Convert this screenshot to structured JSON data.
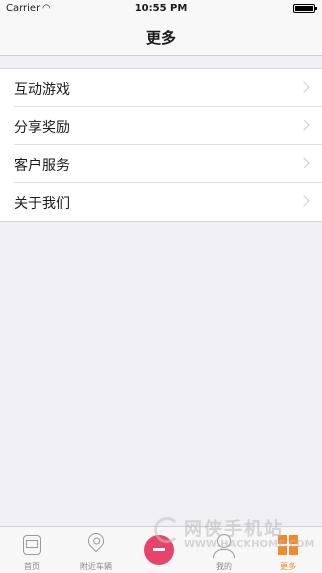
{
  "status_bar": {
    "carrier": "Carrier",
    "wifi_icon": "wifi-icon",
    "time": "10:55 PM",
    "battery_icon": "battery-icon"
  },
  "nav": {
    "title": "更多"
  },
  "menu": {
    "items": [
      {
        "label": "互动游戏",
        "icon": "chevron-right-icon"
      },
      {
        "label": "分享奖励",
        "icon": "chevron-right-icon"
      },
      {
        "label": "客户服务",
        "icon": "chevron-right-icon"
      },
      {
        "label": "关于我们",
        "icon": "chevron-right-icon"
      }
    ]
  },
  "tab_bar": {
    "tabs": [
      {
        "label": "首页",
        "icon": "bus-icon",
        "active": false
      },
      {
        "label": "附近车辆",
        "icon": "location-pin-icon",
        "active": false
      },
      {
        "label": "",
        "icon": "card-icon",
        "active": false
      },
      {
        "label": "我的",
        "icon": "user-icon",
        "active": false
      },
      {
        "label": "更多",
        "icon": "grid-icon",
        "active": true
      }
    ],
    "accent_color": "#f08a2c"
  },
  "watermark": {
    "text_cn": "网侠手机站",
    "text_en": "WWW.HACKHOME.COM"
  }
}
